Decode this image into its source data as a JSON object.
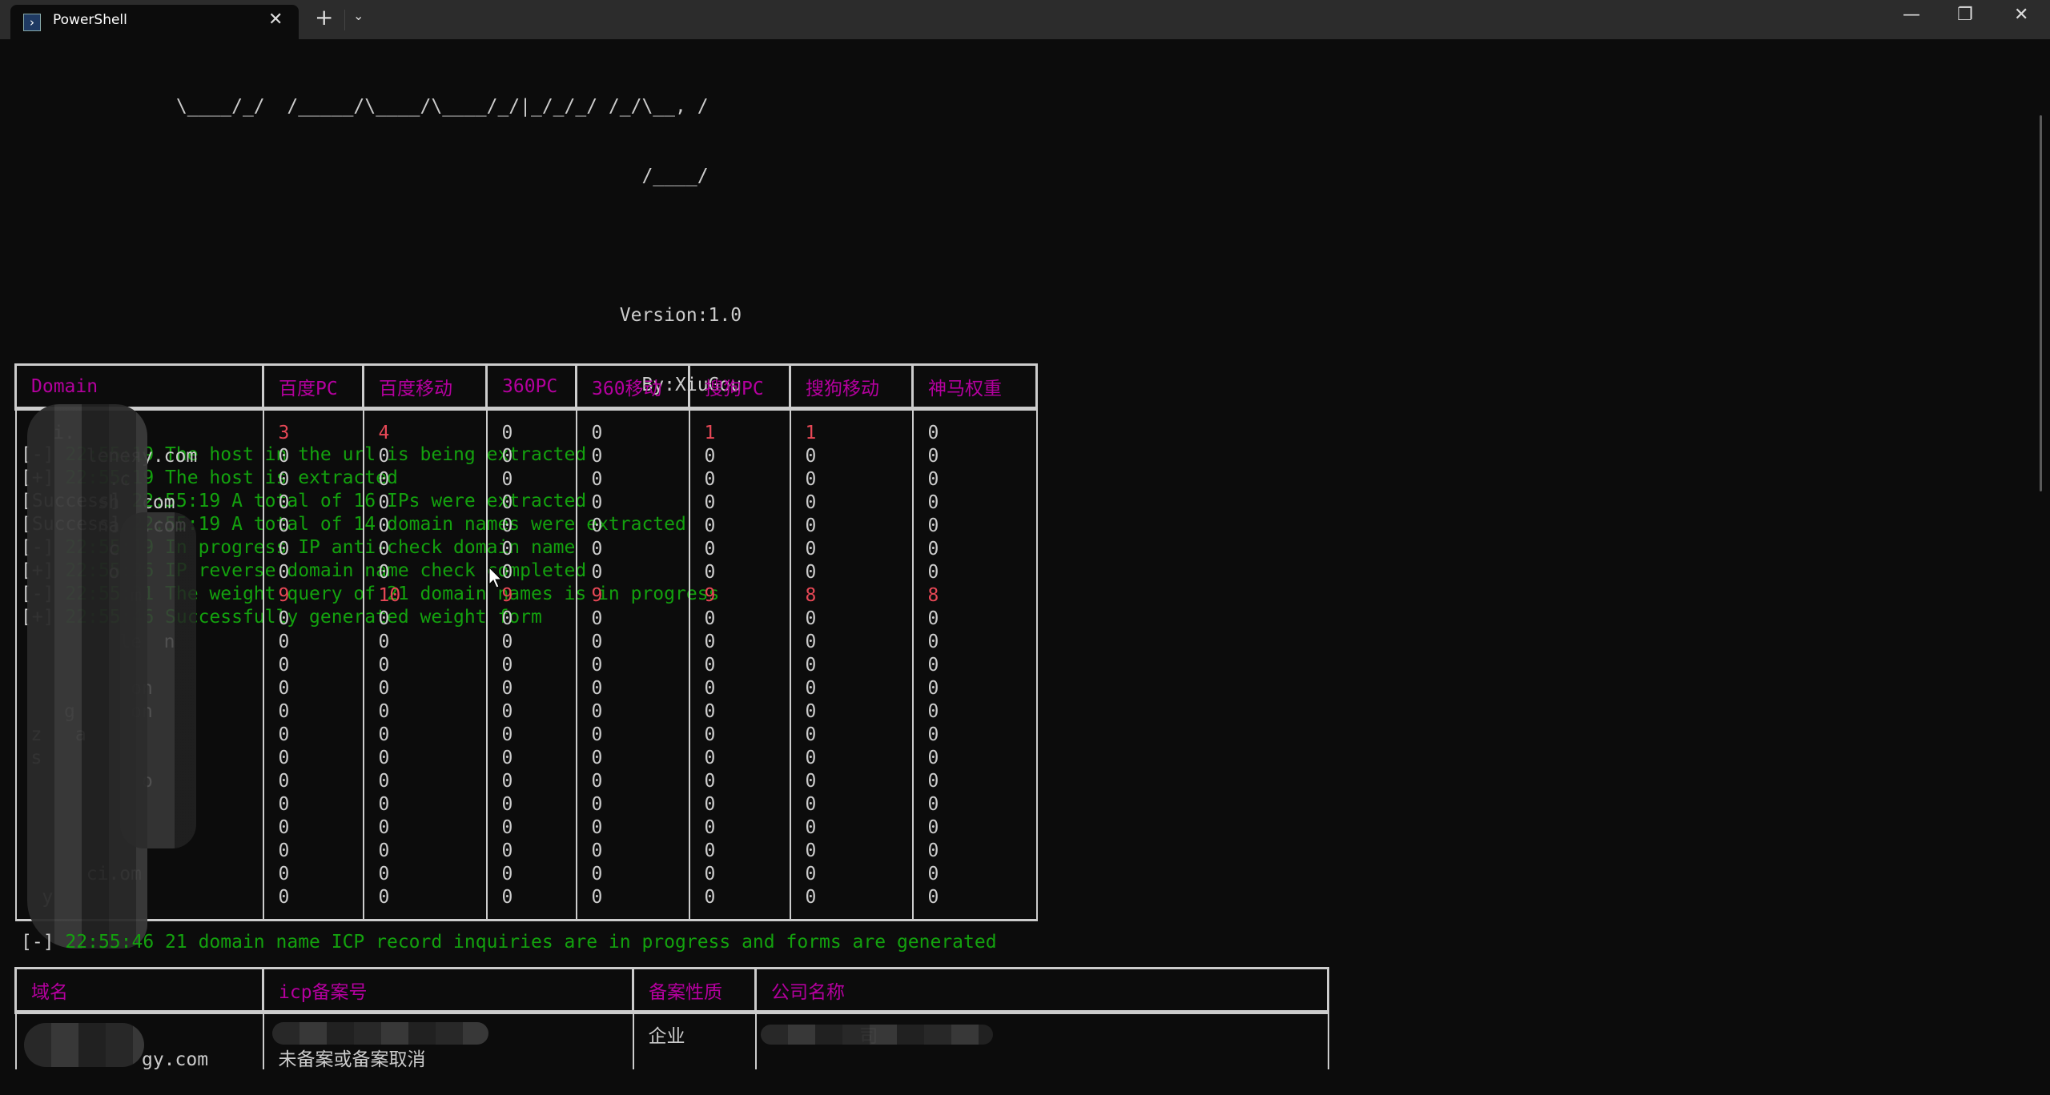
{
  "window": {
    "tab_title": "PowerShell",
    "tab_icon": "powershell-icon",
    "new_tab": "+",
    "dropdown": "⌄",
    "minimize": "—",
    "maximize": "❐",
    "close": "✕"
  },
  "banner": {
    "line1": "\\____/_/  /_____/\\____/\\____/_/|_/_/_/ /_/\\__, /",
    "line2": "/____/",
    "version": "Version:1.0",
    "author": "By:XiuGou"
  },
  "log": [
    {
      "tag": "[-]",
      "text": "22:55:19 The host in the url is being extracted"
    },
    {
      "tag": "[+]",
      "text": "22:55:19 The host is extracted"
    },
    {
      "tag": "[Success]",
      "text": "22:55:19 A total of 16 IPs were extracted"
    },
    {
      "tag": "[Success]",
      "text": "22:55:19 A total of 14 domain names were extracted"
    },
    {
      "tag": "[-]",
      "text": "22:55:19 In progress IP anti-check domain name"
    },
    {
      "tag": "[+]",
      "text": "22:55:26 IP reverse domain name check completed"
    },
    {
      "tag": "[-]",
      "text": "22:55:31 The weight query of 21 domain names is in progress"
    },
    {
      "tag": "[+]",
      "text": "22:55:46 Successfully generated weight form"
    }
  ],
  "weight_table": {
    "headers": [
      "Domain",
      "百度PC",
      "百度移动",
      "360PC",
      "360移动",
      "搜狗PC",
      "搜狗移动",
      "神马权重"
    ],
    "rows": [
      {
        "domain": "  i.",
        "v": [
          3,
          4,
          0,
          0,
          1,
          1,
          0
        ]
      },
      {
        "domain": "     leneяy.com",
        "v": [
          0,
          0,
          0,
          0,
          0,
          0,
          0
        ]
      },
      {
        "domain": "       .c",
        "v": [
          0,
          0,
          0,
          0,
          0,
          0,
          0
        ]
      },
      {
        "domain": "      sh  com",
        "v": [
          0,
          0,
          0,
          0,
          0,
          0,
          0
        ]
      },
      {
        "domain": "      na  .com",
        "v": [
          0,
          0,
          0,
          0,
          0,
          0,
          0
        ]
      },
      {
        "domain": "       c",
        "v": [
          0,
          0,
          0,
          0,
          0,
          0,
          0
        ]
      },
      {
        "domain": "       o",
        "v": [
          0,
          0,
          0,
          0,
          0,
          0,
          0
        ]
      },
      {
        "domain": "         m",
        "v": [
          9,
          10,
          9,
          9,
          9,
          8,
          8
        ]
      },
      {
        "domain": "",
        "v": [
          0,
          0,
          0,
          0,
          0,
          0,
          0
        ]
      },
      {
        "domain": "        le  n",
        "v": [
          0,
          0,
          0,
          0,
          0,
          0,
          0
        ]
      },
      {
        "domain": "",
        "v": [
          0,
          0,
          0,
          0,
          0,
          0,
          0
        ]
      },
      {
        "domain": "         on",
        "v": [
          0,
          0,
          0,
          0,
          0,
          0,
          0
        ]
      },
      {
        "domain": "   g     on",
        "v": [
          0,
          0,
          0,
          0,
          0,
          0,
          0
        ]
      },
      {
        "domain": "z   a",
        "v": [
          0,
          0,
          0,
          0,
          0,
          0,
          0
        ]
      },
      {
        "domain": "s",
        "v": [
          0,
          0,
          0,
          0,
          0,
          0,
          0
        ]
      },
      {
        "domain": "          o",
        "v": [
          0,
          0,
          0,
          0,
          0,
          0,
          0
        ]
      },
      {
        "domain": "",
        "v": [
          0,
          0,
          0,
          0,
          0,
          0,
          0
        ]
      },
      {
        "domain": "",
        "v": [
          0,
          0,
          0,
          0,
          0,
          0,
          0
        ]
      },
      {
        "domain": "",
        "v": [
          0,
          0,
          0,
          0,
          0,
          0,
          0
        ]
      },
      {
        "domain": "     ci.om",
        "v": [
          0,
          0,
          0,
          0,
          0,
          0,
          0
        ]
      },
      {
        "domain": " y",
        "v": [
          0,
          0,
          0,
          0,
          0,
          0,
          0
        ]
      }
    ]
  },
  "icp_log": {
    "tag": "[-]",
    "text": "22:55:46 21 domain name ICP record inquiries are in progress and forms are generated"
  },
  "icp_table": {
    "headers": [
      "域名",
      "icp备案号",
      "备案性质",
      "公司名称"
    ],
    "rows": [
      {
        "domain": "",
        "icp": "",
        "nature": "企业",
        "company": "        司"
      },
      {
        "domain": "          gy.com",
        "icp": "未备案或备案取消",
        "nature": "",
        "company": ""
      }
    ]
  },
  "colors": {
    "background": "#0c0c0c",
    "green": "#13a10e",
    "magenta": "#b4009e",
    "red": "#e74856",
    "text": "#cccccc"
  }
}
